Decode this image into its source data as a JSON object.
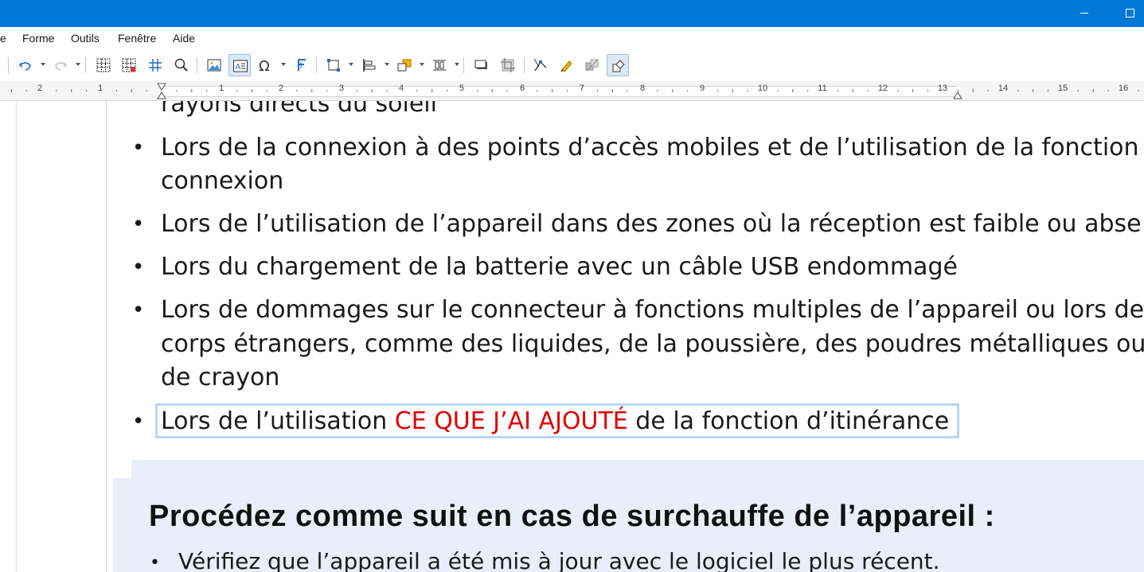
{
  "menubar": {
    "items": [
      "e",
      "Forme",
      "Outils",
      "Fenêtre",
      "Aide"
    ]
  },
  "toolbar": {
    "icons": [
      "undo-icon",
      "redo-icon",
      "grid-icon",
      "grid-snap-icon",
      "helplines-icon",
      "zoom-icon",
      "image-icon",
      "textbox-icon",
      "special-character-icon",
      "fontwork-icon",
      "transformations-icon",
      "align-icon",
      "arrange-icon",
      "distribute-icon",
      "shadow-icon",
      "crop-icon",
      "points-icon",
      "glue-points-icon",
      "toggle-extrusion-icon",
      "shapes-icon"
    ]
  },
  "ruler": {
    "labels": [
      "2",
      "1",
      "1",
      "2",
      "3",
      "4",
      "5",
      "6",
      "7",
      "8",
      "9",
      "10",
      "11",
      "12",
      "13",
      "14",
      "15",
      "16"
    ]
  },
  "document": {
    "partial_line": "rayons directs du soleil",
    "bullets": [
      {
        "lines": [
          "Lors de la connexion à des points d’accès mobiles et de l’utilisation de la fonction",
          "connexion"
        ]
      },
      {
        "lines": [
          "Lors de l’utilisation de l’appareil dans des zones où la réception est faible ou abse"
        ]
      },
      {
        "lines": [
          "Lors du chargement de la batterie avec un câble USB endommagé"
        ]
      },
      {
        "lines": [
          "Lors de dommages sur le connecteur à fonctions multiples de l’appareil ou lors de",
          "corps étrangers, comme des liquides, de la poussière, des poudres métalliques ou",
          "de crayon"
        ]
      }
    ],
    "edited_bullet": {
      "before": "Lors de l’utilisation ",
      "highlight": "CE QUE J’AI AJOUTÉ",
      "after": " de la fonction d’itinérance"
    },
    "box_heading": "Procédez comme suit en cas de surchauffe de l’appareil :",
    "box_item": "Vérifiez que l’appareil a été mis à jour avec le logiciel le plus récent.",
    "bullet_char": "•"
  },
  "colors": {
    "titlebar": "#0078d4",
    "highlight_text": "#e00000",
    "selection_frame": "#b8d7f2",
    "box_background": "#e9eef8"
  }
}
